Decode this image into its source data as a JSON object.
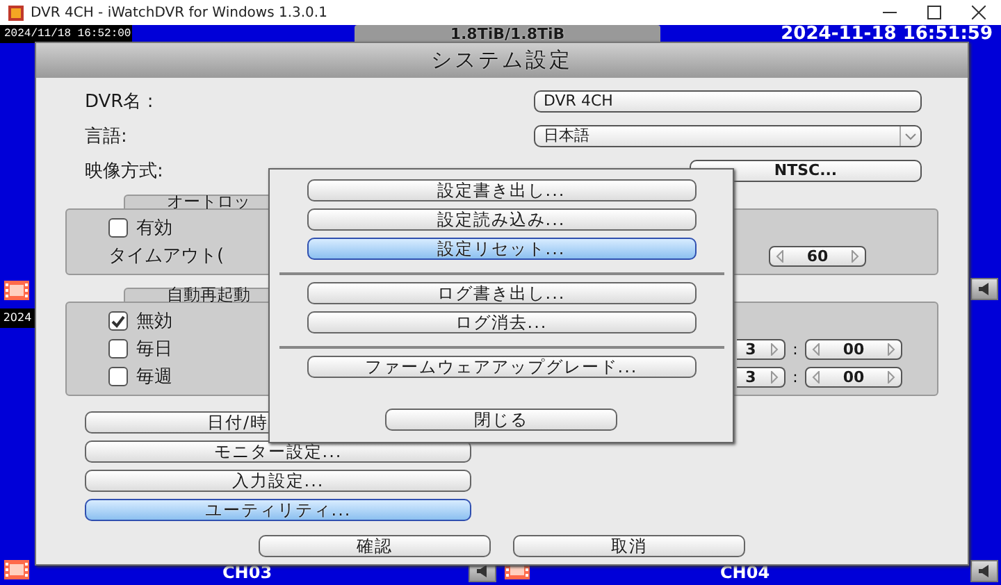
{
  "window": {
    "title": "DVR 4CH - iWatchDVR for Windows 1.3.0.1"
  },
  "top_bar": {
    "left_time": "2024/11/18 16:52:00",
    "storage": "1.8TiB/1.8TiB",
    "clock": "2024-11-18 16:51:59"
  },
  "side_label": "2024",
  "channels": [
    {
      "name": "CH03"
    },
    {
      "name": "CH04"
    }
  ],
  "dialog": {
    "title": "システム設定",
    "fields": [
      {
        "kind": "text",
        "label": "DVR名 :",
        "value": "DVR 4CH"
      },
      {
        "kind": "dropdown",
        "label": "言語:",
        "value": "日本語"
      },
      {
        "kind": "button",
        "label": "映像方式:",
        "value": "NTSC..."
      }
    ],
    "auto_lock": {
      "title": "オートロッ",
      "enable": {
        "label": "有効",
        "checked": false
      },
      "timeout_label": "タイムアウト(",
      "timeout": "60"
    },
    "auto_restart": {
      "title": "自動再起動",
      "options": [
        {
          "label": "無効",
          "checked": true
        },
        {
          "label": "毎日",
          "checked": false
        },
        {
          "label": "毎週",
          "checked": false
        }
      ],
      "times": [
        {
          "hour": "3",
          "separator": ":",
          "minute": "00"
        },
        {
          "hour": "3",
          "separator": ":",
          "minute": "00"
        }
      ]
    },
    "menu_buttons": [
      {
        "label": "日付/時",
        "selected": false
      },
      {
        "label": "モニター設定...",
        "selected": false
      },
      {
        "label": "入力設定...",
        "selected": false
      },
      {
        "label": "ユーティリティ...",
        "selected": true
      }
    ],
    "footer_buttons": [
      "確認",
      "取消"
    ]
  },
  "popup": {
    "groups": [
      [
        {
          "label": "設定書き出し...",
          "selected": false
        },
        {
          "label": "設定読み込み...",
          "selected": false
        },
        {
          "label": "設定リセット...",
          "selected": true
        }
      ],
      [
        {
          "label": "ログ書き出し...",
          "selected": false
        },
        {
          "label": "ログ消去...",
          "selected": false
        }
      ],
      [
        {
          "label": "ファームウェアアップグレード...",
          "selected": false
        }
      ]
    ],
    "close": "閉じる"
  }
}
